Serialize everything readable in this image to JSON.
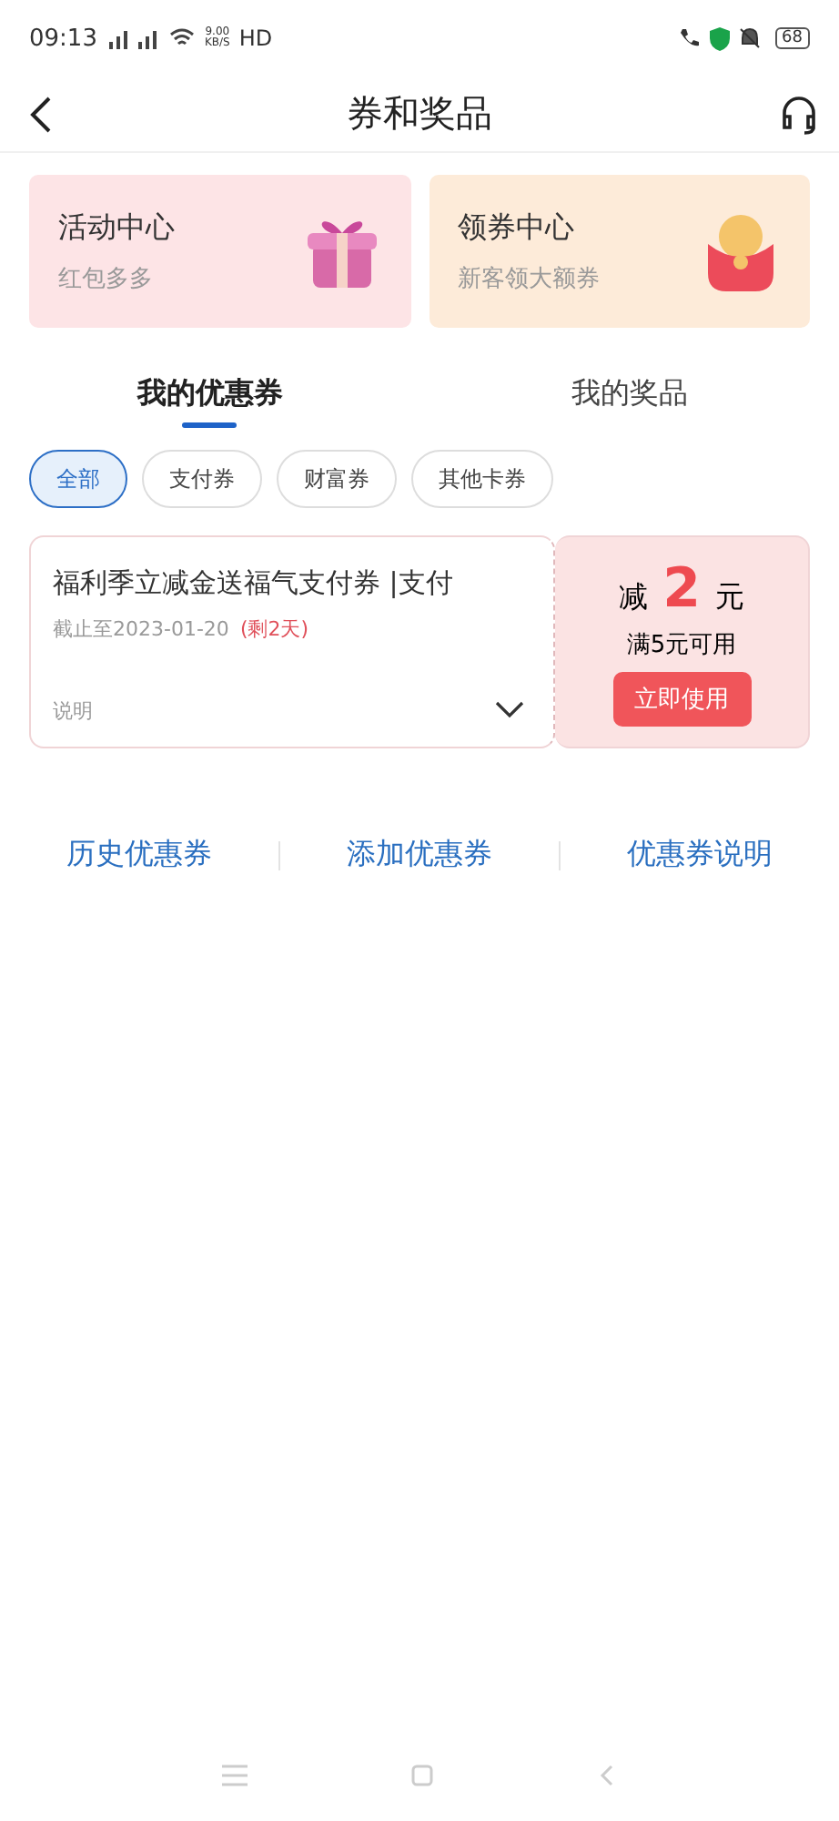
{
  "status_bar": {
    "time": "09:13",
    "speed": "9.00\nKB/S",
    "hd": "HD",
    "battery": "68"
  },
  "header": {
    "title": "券和奖品"
  },
  "promo_cards": [
    {
      "title": "活动中心",
      "subtitle": "红包多多",
      "kind": "gift"
    },
    {
      "title": "领券中心",
      "subtitle": "新客领大额券",
      "kind": "envelope"
    }
  ],
  "tabs": [
    {
      "label": "我的优惠券",
      "selected": true
    },
    {
      "label": "我的奖品",
      "selected": false
    }
  ],
  "filters": [
    {
      "label": "全部",
      "selected": true
    },
    {
      "label": "支付券",
      "selected": false
    },
    {
      "label": "财富券",
      "selected": false
    },
    {
      "label": "其他卡券",
      "selected": false
    }
  ],
  "coupons": [
    {
      "title": "福利季立减金送福气支付券 |支付",
      "expiry": "截止至2023-01-20",
      "remaining": "(剩2天)",
      "note": "说明",
      "expanded": false,
      "prefix": "减",
      "amount": "2",
      "unit": "元",
      "condition": "满5元可用",
      "action": "立即使用"
    }
  ],
  "links": [
    "历史优惠券",
    "添加优惠券",
    "优惠券说明"
  ]
}
